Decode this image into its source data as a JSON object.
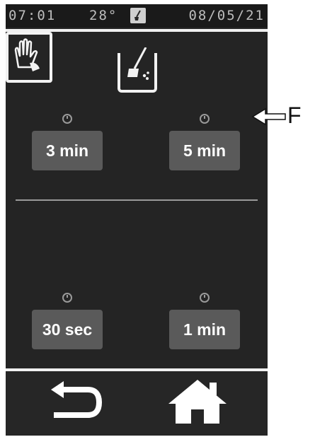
{
  "status_bar": {
    "time": "07:01",
    "temperature": "28°",
    "date": "08/05/21"
  },
  "sections": [
    {
      "icon": "cleaning-bucket-icon",
      "options": [
        {
          "label": "3 min"
        },
        {
          "label": "5 min"
        }
      ]
    },
    {
      "icon": "wipe-glove-icon",
      "options": [
        {
          "label": "30 sec"
        },
        {
          "label": "1 min"
        }
      ]
    }
  ],
  "bottom_nav": {
    "back_icon": "back-arrow-icon",
    "home_icon": "home-icon"
  },
  "callout": {
    "letter": "F"
  },
  "colors": {
    "background": "#262626",
    "button": "#5a5a5a",
    "text": "#ffffff",
    "separator": "#f0f0f0"
  }
}
